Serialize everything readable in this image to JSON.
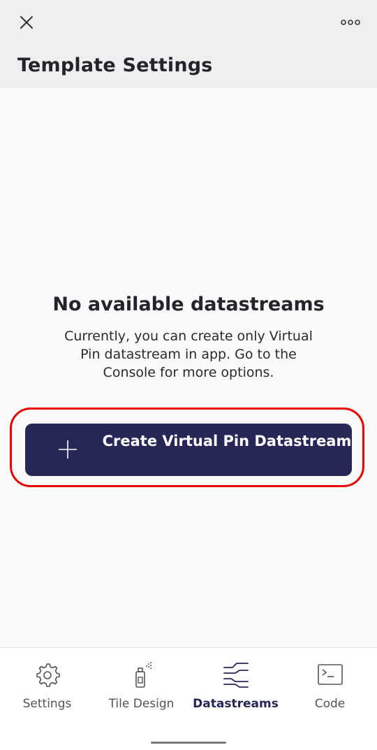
{
  "header": {
    "title": "Template Settings",
    "close_icon": "close-icon",
    "more_icon": "more-options-icon"
  },
  "empty_state": {
    "title": "No available datastreams",
    "description": "Currently, you can create only Virtual Pin datastream in app. Go to the Console for more options."
  },
  "create_button": {
    "label": "Create Virtual Pin Datastream",
    "icon": "plus-icon",
    "color": "#262756"
  },
  "highlight_color": "#e60000",
  "bottom_nav": {
    "items": [
      {
        "label": "Settings",
        "icon": "gear-icon",
        "active": false
      },
      {
        "label": "Tile Design",
        "icon": "spray-can-icon",
        "active": false
      },
      {
        "label": "Datastreams",
        "icon": "datastreams-icon",
        "active": true
      },
      {
        "label": "Code",
        "icon": "terminal-icon",
        "active": false
      }
    ]
  }
}
